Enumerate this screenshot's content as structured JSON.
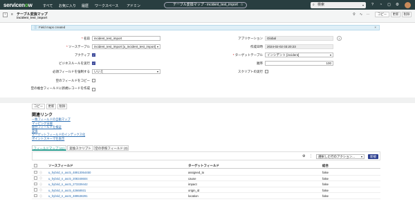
{
  "topbar": {
    "logo_a": "servicen",
    "logo_o": "o",
    "logo_b": "w",
    "nav": [
      "すべて",
      "お気に入り",
      "履歴",
      "ワークスペース",
      "アドミン"
    ],
    "context_title": "テーブル変換マップ - incident_test_import",
    "search_placeholder": "検索",
    "icons": [
      "help-icon",
      "notification-icon",
      "chat-icon",
      "settings-icon"
    ]
  },
  "header": {
    "title": "テーブル変換マップ",
    "subtitle": "incident_test_import",
    "buttons": [
      "コピー",
      "更新",
      "削除"
    ]
  },
  "info_message": "Field maps created",
  "form": {
    "name_label": "名前",
    "name_value": "incident_test_import",
    "source_table_label": "ソーステーブル",
    "source_table_value": "incident_test_import [u_incident_test_import]",
    "active_label": "アクティブ",
    "run_business_rules_label": "ビジネスルールを実行",
    "enforce_mandatory_label": "必須フィールドを強制する",
    "enforce_mandatory_value": "いいえ",
    "copy_empty_label": "空のフィールドをコピー",
    "create_new_label": "空の複合フィールドに新規レコードを作成",
    "application_label": "アプリケーション",
    "application_value": "Global",
    "created_label": "作成日時",
    "created_value": "2024-02-02 03:20:23",
    "target_table_label": "ターゲットテーブル",
    "target_table_value": "インシデント [incident]",
    "order_label": "順序",
    "order_value": "100",
    "run_script_label": "スクリプトの実行"
  },
  "footer_buttons": [
    "コピー",
    "更新",
    "削除"
  ],
  "related_links": {
    "title": "関連リンク",
    "links": [
      "一致フィールドの自動マップ",
      "マッピング支援",
      "組合フィールドを検証",
      "変換",
      "ターゲットフィールドのインデックス化",
      "ポイントスキーマを表示"
    ]
  },
  "tabs": [
    "フィールドマップ (41)",
    "変換スクリプト",
    "空の参照フィールド (0)"
  ],
  "list": {
    "action_placeholder": "選択した行のアクション...",
    "new_button": "新規",
    "columns": [
      "ソースフィールド",
      "ターゲットフィールド",
      "結合"
    ],
    "rows": [
      {
        "source": "u_hybrid_n_asc5_48913064450",
        "target": "assigned_to",
        "coalesce": "false"
      },
      {
        "source": "u_hybrid_n_asc5_208348604",
        "target": "cause",
        "coalesce": "false"
      },
      {
        "source": "u_hybrid_n_asc5_273339442",
        "target": "impact",
        "coalesce": "false"
      },
      {
        "source": "u_hybrid_n_asc5_42668931",
        "target": "origin_id",
        "coalesce": "false"
      },
      {
        "source": "u_hybrid_n_asc5_489538291",
        "target": "location",
        "coalesce": "false"
      }
    ]
  }
}
